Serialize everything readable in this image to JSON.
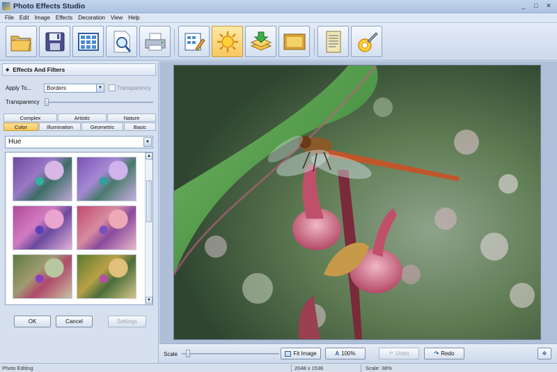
{
  "window": {
    "title": "Photo Effects Studio",
    "controls": [
      "_",
      "□",
      "✕"
    ]
  },
  "menu": [
    "File",
    "Edit",
    "Image",
    "Effects",
    "Decoration",
    "View",
    "Help"
  ],
  "toolbar": {
    "buttons": [
      {
        "name": "open-icon"
      },
      {
        "name": "save-icon"
      },
      {
        "name": "grid-icon"
      },
      {
        "name": "preview-icon"
      },
      {
        "name": "print-icon"
      },
      {
        "name": "edit-icon"
      },
      {
        "name": "effects-sun-icon",
        "active": true
      },
      {
        "name": "layers-icon"
      },
      {
        "name": "frame-icon"
      },
      {
        "name": "document-icon"
      },
      {
        "name": "settings-icon"
      }
    ]
  },
  "panel": {
    "title": "Effects And Filters",
    "apply_to_label": "Apply To...",
    "apply_to_value": "Borders",
    "transparency_check_label": "Transparency",
    "transparency_slider_label": "Transparency",
    "transparency_level": 0,
    "tabs_row1": [
      "Complex",
      "Artistic",
      "Nature"
    ],
    "tabs_row2": [
      "Color",
      "Illumination",
      "Geometric",
      "Basic"
    ],
    "selected_tab": "Color",
    "effect_value": "Hue",
    "ok": "OK",
    "cancel": "Cancel",
    "settings": "Settings"
  },
  "bottom": {
    "scale_label": "Scale",
    "scale_level": 0.05,
    "fit_image": "Fit Image",
    "zoom_100": "100%",
    "undo": "Undo",
    "redo": "Redo"
  },
  "status": {
    "mode": "Photo Editing",
    "dimensions": "2048 x 1536",
    "scale": "Scale: 38%"
  }
}
